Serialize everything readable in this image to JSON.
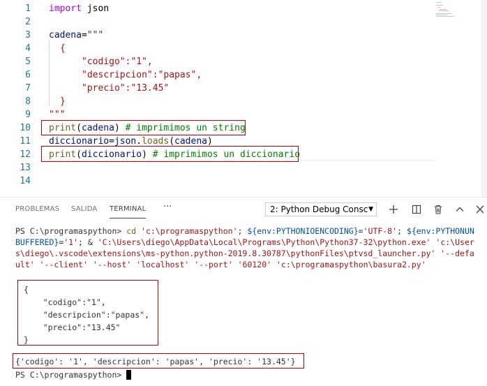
{
  "editor": {
    "line_numbers": [
      "1",
      "2",
      "3",
      "4",
      "5",
      "6",
      "7",
      "8",
      "9",
      "10",
      "11",
      "12",
      "13",
      "14"
    ],
    "code": {
      "l1_kw": "import",
      "l1_mod": " json",
      "l3_var": "cadena",
      "l3_eq": "=",
      "l3_str": "\"\"\"",
      "l4_brace": "{",
      "l5": "\"codigo\":\"1\",",
      "l6": "\"descripcion\":\"papas\",",
      "l7": "\"precio\":\"13.45\"",
      "l8_brace": "}",
      "l9": "\"\"\"",
      "l10_fn": "print",
      "l10_open": "(",
      "l10_arg": "cadena",
      "l10_close": ")",
      "l10_comment": " # imprimimos un string",
      "l11_var": "diccionario",
      "l11_eq": "=",
      "l11_obj": "json",
      "l11_dot": ".",
      "l11_fn": "loads",
      "l11_open": "(",
      "l11_arg": "cadena",
      "l11_close": ")",
      "l12_fn": "print",
      "l12_open": "(",
      "l12_arg": "diccionario",
      "l12_close": ")",
      "l12_comment": " # imprimimos un diccionario"
    }
  },
  "panel": {
    "tabs": [
      "PROBLEMAS",
      "SALIDA",
      "TERMINAL"
    ],
    "more": "···",
    "terminal_select": "2: Python Debug Consc",
    "icons": [
      "plus-icon",
      "split-icon",
      "trash-icon",
      "chevron-up-icon",
      "close-icon"
    ]
  },
  "terminal": {
    "prompt": "PS C:\\programaspython>",
    "cmd1_a": " cd ",
    "cmd1_b": "'c:\\programaspython'",
    "cmd1_c": "; ",
    "cmd1_d": "${env:PYTHONIOENCODING}",
    "cmd1_e": "=",
    "cmd1_f": "'UTF-8'",
    "cmd1_g": "; ",
    "cmd1_h": "${env:PYTHONUN",
    "cmd2_a": "BUFFERED}",
    "cmd2_b": "=",
    "cmd2_c": "'1'",
    "cmd2_d": "; & ",
    "cmd2_e": "'C:\\Users\\diego\\AppData\\Local\\Programs\\Python\\Python37-32\\python.exe'",
    "cmd2_f": " ",
    "cmd2_g": "'c:\\User",
    "cmd3_a": "s\\diego\\.vscode\\extensions\\ms-python.python-2019.8.30787\\pythonFiles\\ptvsd_launcher.py'",
    "cmd3_b": " ",
    "cmd3_c": "'--defa",
    "cmd4_a": "ult'",
    "cmd4_b": " ",
    "cmd4_c": "'--client'",
    "cmd4_d": " ",
    "cmd4_e": "'--host'",
    "cmd4_f": " ",
    "cmd4_g": "'localhost'",
    "cmd4_h": " ",
    "cmd4_i": "'--port'",
    "cmd4_j": " ",
    "cmd4_k": "'60120'",
    "cmd4_l": " ",
    "cmd4_m": "'c:\\programaspython\\basura2.py'",
    "out_lines": [
      "{",
      "    \"codigo\":\"1\",",
      "    \"descripcion\":\"papas\",",
      "    \"precio\":\"13.45\"",
      "}"
    ],
    "dict_line": "{'codigo': '1', 'descripcion': 'papas', 'precio': '13.45'}",
    "final_prompt": "PS C:\\programaspython>"
  }
}
